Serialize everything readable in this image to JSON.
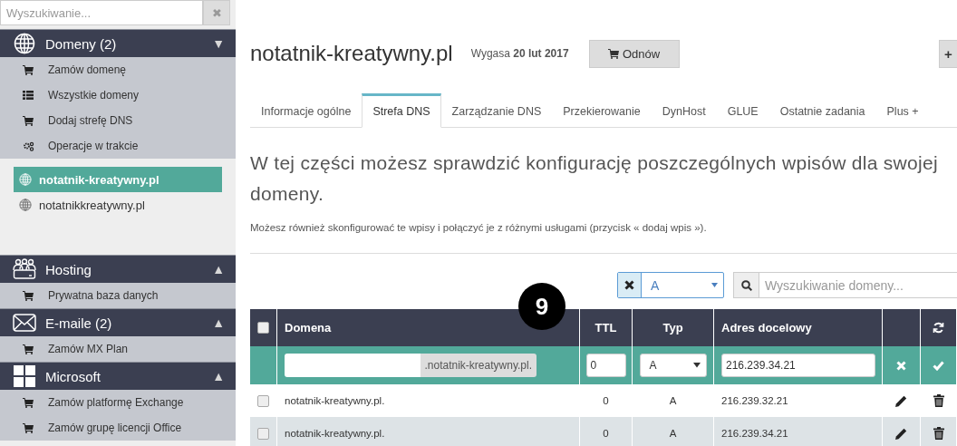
{
  "sidebar": {
    "search": {
      "placeholder": "Wyszukiwanie...",
      "clear": "✖"
    },
    "groups": [
      {
        "title": "Domeny (2)",
        "arrow": "▼",
        "kind": "globe",
        "items": [
          {
            "label": "Zamów domenę",
            "kind": "cart"
          },
          {
            "label": "Wszystkie domeny",
            "kind": "list"
          },
          {
            "label": "Dodaj strefę DNS",
            "kind": "cart"
          },
          {
            "label": "Operacje w trakcie",
            "kind": "gears"
          }
        ],
        "domains": [
          {
            "label": "notatnik-kreatywny.pl",
            "selected": true
          },
          {
            "label": "notatnikkreatywny.pl",
            "selected": false
          }
        ]
      },
      {
        "title": "Hosting",
        "arrow": "▲",
        "kind": "people",
        "items": [
          {
            "label": "Prywatna baza danych",
            "kind": "cart"
          }
        ]
      },
      {
        "title": "E-maile (2)",
        "arrow": "▲",
        "kind": "mail",
        "items": [
          {
            "label": "Zamów MX Plan",
            "kind": "cart"
          }
        ]
      },
      {
        "title": "Microsoft",
        "arrow": "▲",
        "kind": "windows",
        "items": [
          {
            "label": "Zamów platformę Exchange",
            "kind": "cart"
          },
          {
            "label": "Zamów grupę licencji Office",
            "kind": "cart"
          }
        ]
      }
    ]
  },
  "header": {
    "title": "notatnik-kreatywny.pl",
    "expiry": "Wygasa **20 lut 2017**",
    "renew_button": "Odnów",
    "plus_button": "+"
  },
  "tabs": [
    {
      "label": "Informacje ogólne",
      "selected": false
    },
    {
      "label": "Strefa DNS",
      "selected": true
    },
    {
      "label": "Zarządzanie DNS",
      "selected": false
    },
    {
      "label": "Przekierowanie",
      "selected": false
    },
    {
      "label": "DynHost",
      "selected": false
    },
    {
      "label": "GLUE",
      "selected": false
    },
    {
      "label": "Ostatnie zadania",
      "selected": false
    },
    {
      "label": "Plus +",
      "selected": false
    }
  ],
  "intro": {
    "heading": "W tej części możesz sprawdzić konfigurację poszczególnych wpisów dla swojej domeny.",
    "note": "Możesz również skonfigurować te wpisy i połączyć je z różnymi usługami (przycisk « dodaj wpis »)."
  },
  "filter": {
    "type_value": "A",
    "search_placeholder": "Wyszukiwanie domeny..."
  },
  "badge": "9",
  "table": {
    "all_checked": false,
    "columns": [
      "Domena",
      "TTL",
      "Typ",
      "Adres docelowy"
    ],
    "new_row": {
      "suffix": ".notatnik-kreatywny.pl.",
      "ttl": "0",
      "type": "A",
      "target": "216.239.34.21"
    },
    "rows": [
      {
        "domain": "notatnik-kreatywny.pl.",
        "ttl": "0",
        "type": "A",
        "target": "216.239.32.21",
        "checked": false
      },
      {
        "domain": "notatnik-kreatywny.pl.",
        "ttl": "0",
        "type": "A",
        "target": "216.239.34.21",
        "checked": false
      }
    ]
  }
}
